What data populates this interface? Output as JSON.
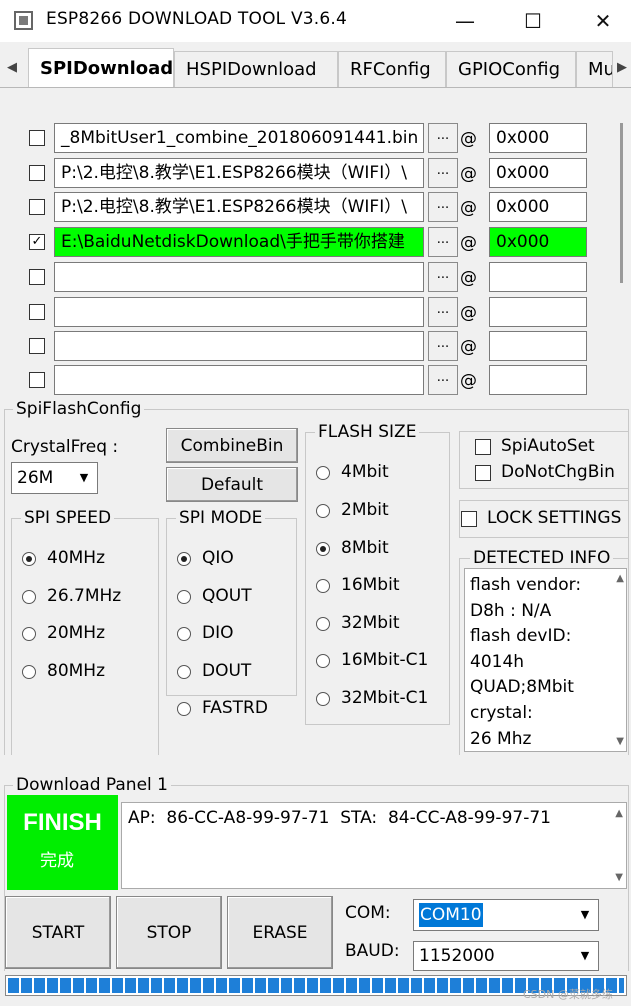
{
  "window": {
    "title": "ESP8266 DOWNLOAD TOOL V3.6.4",
    "minimize": "—",
    "maximize": "☐",
    "close": "✕"
  },
  "tabs": {
    "left_arrow": "◀",
    "right_arrow": "▶",
    "items": [
      "SPIDownload",
      "HSPIDownload",
      "RFConfig",
      "GPIOConfig",
      "Mu"
    ]
  },
  "files": [
    {
      "checked": false,
      "mark": "",
      "path": "_8MbitUser1_combine_201806091441.bin",
      "dots": "...",
      "at": "@",
      "addr": "0x000",
      "green": false
    },
    {
      "checked": false,
      "mark": "",
      "path": "P:\\2.电控\\8.教学\\E1.ESP8266模块（WIFI）\\",
      "dots": "...",
      "at": "@",
      "addr": "0x000",
      "green": false
    },
    {
      "checked": false,
      "mark": "",
      "path": "P:\\2.电控\\8.教学\\E1.ESP8266模块（WIFI）\\",
      "dots": "...",
      "at": "@",
      "addr": "0x000",
      "green": false
    },
    {
      "checked": true,
      "mark": "✓",
      "path": "E:\\BaiduNetdiskDownload\\手把手带你搭建",
      "dots": "...",
      "at": "@",
      "addr": "0x000",
      "green": true
    },
    {
      "checked": false,
      "mark": "",
      "path": "",
      "dots": "...",
      "at": "@",
      "addr": "",
      "green": false
    },
    {
      "checked": false,
      "mark": "",
      "path": "",
      "dots": "...",
      "at": "@",
      "addr": "",
      "green": false
    },
    {
      "checked": false,
      "mark": "",
      "path": "",
      "dots": "...",
      "at": "@",
      "addr": "",
      "green": false
    },
    {
      "checked": false,
      "mark": "",
      "path": "",
      "dots": "...",
      "at": "@",
      "addr": "",
      "green": false
    }
  ],
  "spiflash": {
    "group_label": "SpiFlashConfig",
    "crystal_label": "CrystalFreq :",
    "crystal_value": "26M",
    "combine_btn": "CombineBin",
    "default_btn": "Default",
    "spi_speed": {
      "label": "SPI SPEED",
      "options": [
        "40MHz",
        "26.7MHz",
        "20MHz",
        "80MHz"
      ],
      "selected": 0
    },
    "spi_mode": {
      "label": "SPI MODE",
      "options": [
        "QIO",
        "QOUT",
        "DIO",
        "DOUT",
        "FASTRD"
      ],
      "selected": 0
    },
    "flash_size": {
      "label": "FLASH SIZE",
      "options": [
        "4Mbit",
        "2Mbit",
        "8Mbit",
        "16Mbit",
        "32Mbit",
        "16Mbit-C1",
        "32Mbit-C1"
      ],
      "selected": 2
    },
    "spi_auto_set": "SpiAutoSet",
    "do_not_chg_bin": "DoNotChgBin",
    "lock_settings": "LOCK SETTINGS",
    "detected_label": "DETECTED INFO",
    "detected_lines": [
      "flash vendor:",
      "D8h : N/A",
      "flash devID:",
      "4014h",
      "QUAD;8Mbit",
      "crystal:",
      "26 Mhz"
    ]
  },
  "download": {
    "panel_label": "Download Panel 1",
    "finish_en": "FINISH",
    "finish_cn": "完成",
    "log": "AP:  86-CC-A8-99-97-71  STA:  84-CC-A8-99-97-71",
    "start": "START",
    "stop": "STOP",
    "erase": "ERASE",
    "com_label": "COM:",
    "com_value": "COM10",
    "baud_label": "BAUD:",
    "baud_value": "1152000",
    "progress": 1.0
  },
  "colors": {
    "finish_green": "#00ee00",
    "path_green": "#00ff00",
    "progress_blue": "#1e7fd8",
    "highlight": "#0078d7"
  },
  "watermark": "CSDN @菜就多练"
}
